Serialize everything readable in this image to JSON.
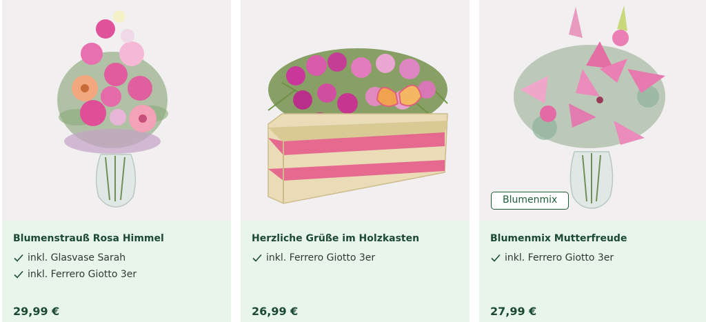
{
  "products": [
    {
      "title": "Blumenstrauß Rosa Himmel",
      "features": [
        "inkl. Glasvase Sarah",
        "inkl. Ferrero Giotto 3er"
      ],
      "price": "29,99 €",
      "image": "pink-rose-gerbera-bouquet-in-glass-vase"
    },
    {
      "title": "Herzliche Grüße im Holzkasten",
      "features": [
        "inkl. Ferrero Giotto 3er"
      ],
      "price": "26,99 €",
      "image": "pink-carnations-in-wooden-crate-with-butterfly"
    },
    {
      "title": "Blumenmix Mutterfreude",
      "badge": "Blumenmix",
      "features": [
        "inkl. Ferrero Giotto 3er"
      ],
      "price": "27,99 €",
      "image": "pink-lily-bouquet-in-glass-vase"
    }
  ],
  "icons": {
    "check": "check-icon"
  },
  "colors": {
    "card_info_bg": "#e8f5ea",
    "title": "#1c4a30",
    "badge_border": "#1d5a36",
    "image_bg": "#f1efef"
  }
}
